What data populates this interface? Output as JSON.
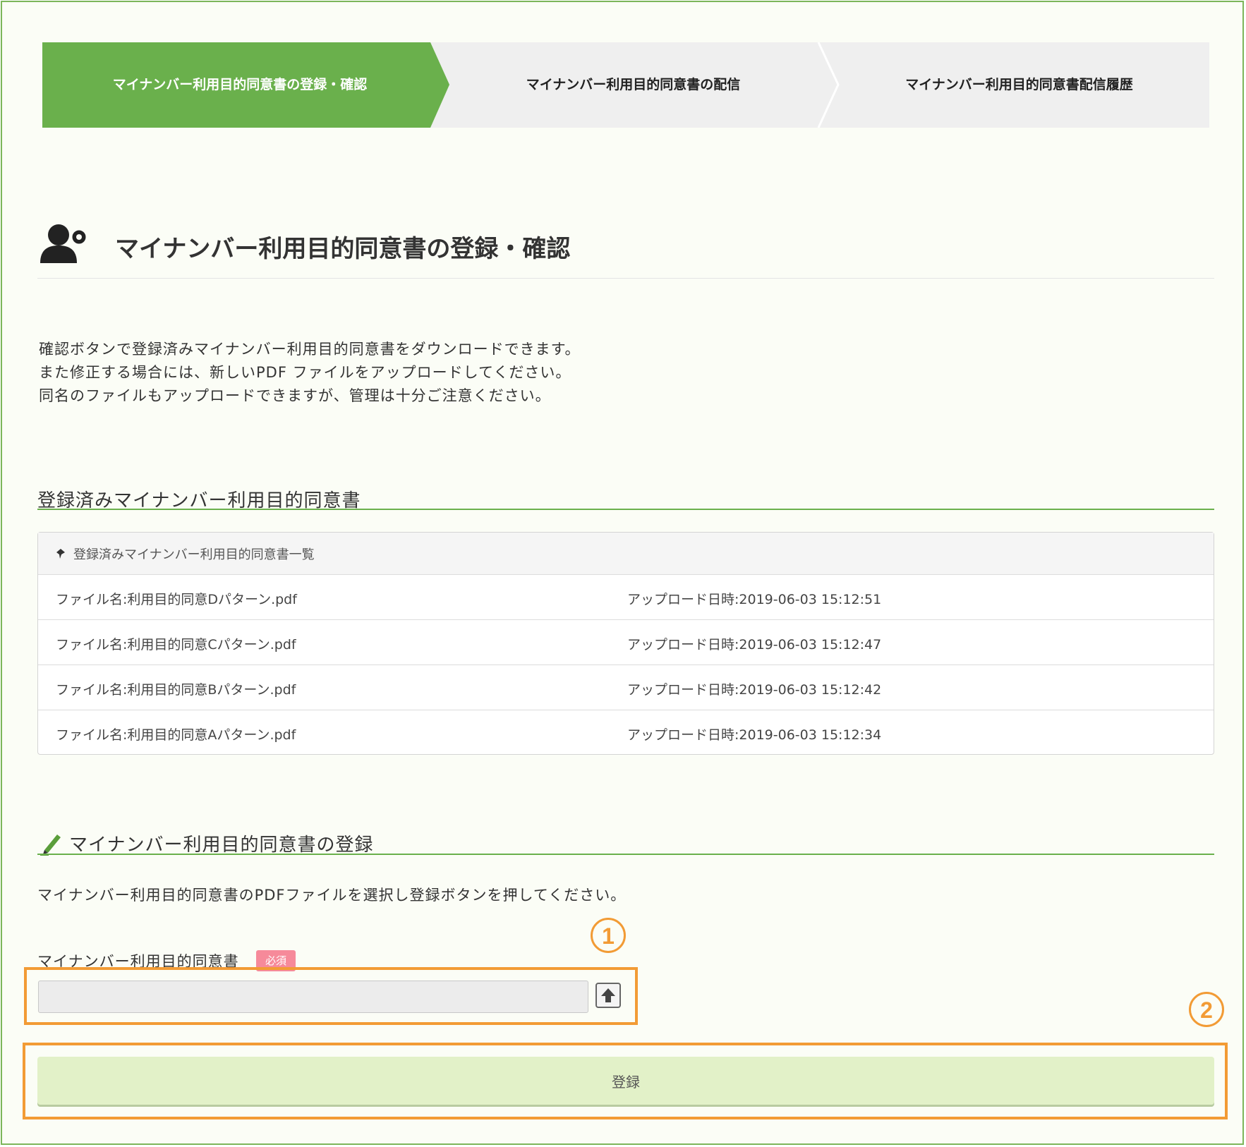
{
  "steps": [
    {
      "label": "マイナンバー利用目的同意書の登録・確認",
      "active": true
    },
    {
      "label": "マイナンバー利用目的同意書の配信",
      "active": false
    },
    {
      "label": "マイナンバー利用目的同意書配信履歴",
      "active": false
    }
  ],
  "page": {
    "title": "マイナンバー利用目的同意書の登録・確認",
    "description": [
      "確認ボタンで登録済みマイナンバー利用目的同意書をダウンロードできます。",
      "また修正する場合には、新しいPDF ファイルをアップロードしてください。",
      "同名のファイルもアップロードできますが、管理は十分ご注意ください。"
    ]
  },
  "registered": {
    "section_title": "登録済みマイナンバー利用目的同意書",
    "panel_title": "登録済みマイナンバー利用目的同意書一覧",
    "files": [
      {
        "name": "ファイル名:利用目的同意Dパターン.pdf",
        "uploaded": "アップロード日時:2019-06-03 15:12:51"
      },
      {
        "name": "ファイル名:利用目的同意Cパターン.pdf",
        "uploaded": "アップロード日時:2019-06-03 15:12:47"
      },
      {
        "name": "ファイル名:利用目的同意Bパターン.pdf",
        "uploaded": "アップロード日時:2019-06-03 15:12:42"
      },
      {
        "name": "ファイル名:利用目的同意Aパターン.pdf",
        "uploaded": "アップロード日時:2019-06-03 15:12:34"
      }
    ]
  },
  "register": {
    "section_title": "マイナンバー利用目的同意書の登録",
    "instruction": "マイナンバー利用目的同意書のPDFファイルを選択し登録ボタンを押してください。",
    "field_label": "マイナンバー利用目的同意書",
    "required_badge": "必須",
    "file_value": "",
    "submit_label": "登録"
  },
  "annotations": {
    "marker1": "1",
    "marker2": "2",
    "color": "#f29b35"
  },
  "colors": {
    "accent": "#6ab04c",
    "step_inactive": "#efefef",
    "frame_border": "#7cb65a",
    "required": "#f68a9a",
    "submit_bg": "#e2f1c8"
  }
}
